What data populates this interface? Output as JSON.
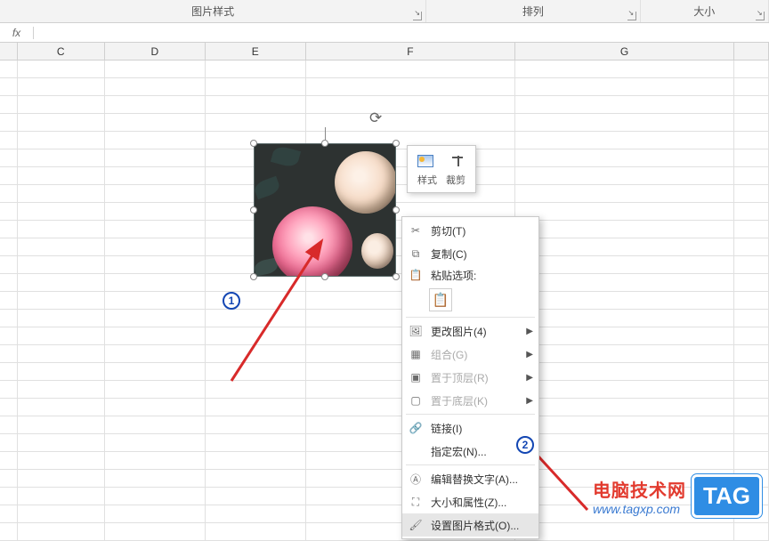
{
  "ribbon": {
    "groups": [
      {
        "label": "图片样式"
      },
      {
        "label": "排列"
      },
      {
        "label": "大小"
      }
    ]
  },
  "formula_bar": {
    "fx": "fx",
    "value": ""
  },
  "columns": [
    "C",
    "D",
    "E",
    "F",
    "G",
    ""
  ],
  "mini_toolbar": {
    "style": "样式",
    "crop": "裁剪"
  },
  "context_menu": {
    "cut": "剪切(T)",
    "copy": "复制(C)",
    "paste_options": "粘贴选项:",
    "change_pic": "更改图片(4)",
    "group": "组合(G)",
    "bring_front": "置于顶层(R)",
    "send_back": "置于底层(K)",
    "link": "链接(I)",
    "assign_macro": "指定宏(N)...",
    "edit_alt": "编辑替换文字(A)...",
    "size_props": "大小和属性(Z)...",
    "format_pic": "设置图片格式(O)..."
  },
  "annotations": {
    "badge1": "1",
    "badge2": "2"
  },
  "watermark": {
    "line1": "电脑技术网",
    "line2": "www.tagxp.com",
    "tag": "TAG"
  }
}
